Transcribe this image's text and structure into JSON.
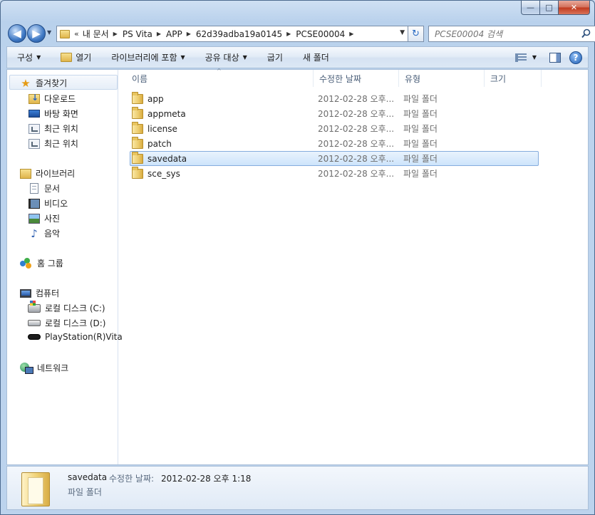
{
  "window": {
    "caption": {
      "minimize": "—",
      "maximize": "□",
      "close": "✕"
    }
  },
  "nav": {
    "back_icon": "◀",
    "forward_icon": "▶",
    "recent_icon": "▼",
    "address_more": "«",
    "breadcrumbs": [
      "내 문서",
      "PS Vita",
      "APP",
      "62d39adba19a0145",
      "PCSE00004"
    ],
    "search_placeholder": "PCSE00004 검색"
  },
  "toolbar": {
    "organize": "구성",
    "open": "열기",
    "include_library": "라이브러리에 포함",
    "share": "공유 대상",
    "burn": "굽기",
    "new_folder": "새 폴더",
    "help": "?"
  },
  "sidebar": {
    "favorites": {
      "label": "즐겨찾기",
      "items": [
        {
          "label": "다운로드",
          "icon": "download-icon"
        },
        {
          "label": "바탕 화면",
          "icon": "desktop-icon"
        },
        {
          "label": "최근 위치",
          "icon": "recent-places-icon"
        },
        {
          "label": "최근 위치",
          "icon": "recent-places-icon"
        }
      ]
    },
    "libraries": {
      "label": "라이브러리",
      "items": [
        {
          "label": "문서",
          "icon": "documents-icon"
        },
        {
          "label": "비디오",
          "icon": "videos-icon"
        },
        {
          "label": "사진",
          "icon": "pictures-icon"
        },
        {
          "label": "음악",
          "icon": "music-icon"
        }
      ]
    },
    "homegroup": {
      "label": "홈 그룹"
    },
    "computer": {
      "label": "컴퓨터",
      "items": [
        {
          "label": "로컬 디스크 (C:)",
          "icon": "drive-c-icon"
        },
        {
          "label": "로컬 디스크 (D:)",
          "icon": "drive-d-icon"
        },
        {
          "label": "PlayStation(R)Vita",
          "icon": "vita-device-icon"
        }
      ]
    },
    "network": {
      "label": "네트워크"
    }
  },
  "columns": {
    "name": "이름",
    "modified": "수정한 날짜",
    "type": "유형",
    "size": "크기",
    "sort_indicator": "^"
  },
  "files": [
    {
      "name": "app",
      "modified": "2012-02-28 오후...",
      "type": "파일 폴더",
      "selected": false
    },
    {
      "name": "appmeta",
      "modified": "2012-02-28 오후...",
      "type": "파일 폴더",
      "selected": false
    },
    {
      "name": "license",
      "modified": "2012-02-28 오후...",
      "type": "파일 폴더",
      "selected": false
    },
    {
      "name": "patch",
      "modified": "2012-02-28 오후...",
      "type": "파일 폴더",
      "selected": false
    },
    {
      "name": "savedata",
      "modified": "2012-02-28 오후...",
      "type": "파일 폴더",
      "selected": true
    },
    {
      "name": "sce_sys",
      "modified": "2012-02-28 오후...",
      "type": "파일 폴더",
      "selected": false
    }
  ],
  "details": {
    "name": "savedata",
    "modified_label": "수정한 날짜:",
    "modified_value": "2012-02-28 오후 1:18",
    "type": "파일 폴더"
  },
  "colors": {
    "selection": "#cde4fb",
    "selection_border": "#84acdd",
    "chrome": "#bcd3ed"
  }
}
